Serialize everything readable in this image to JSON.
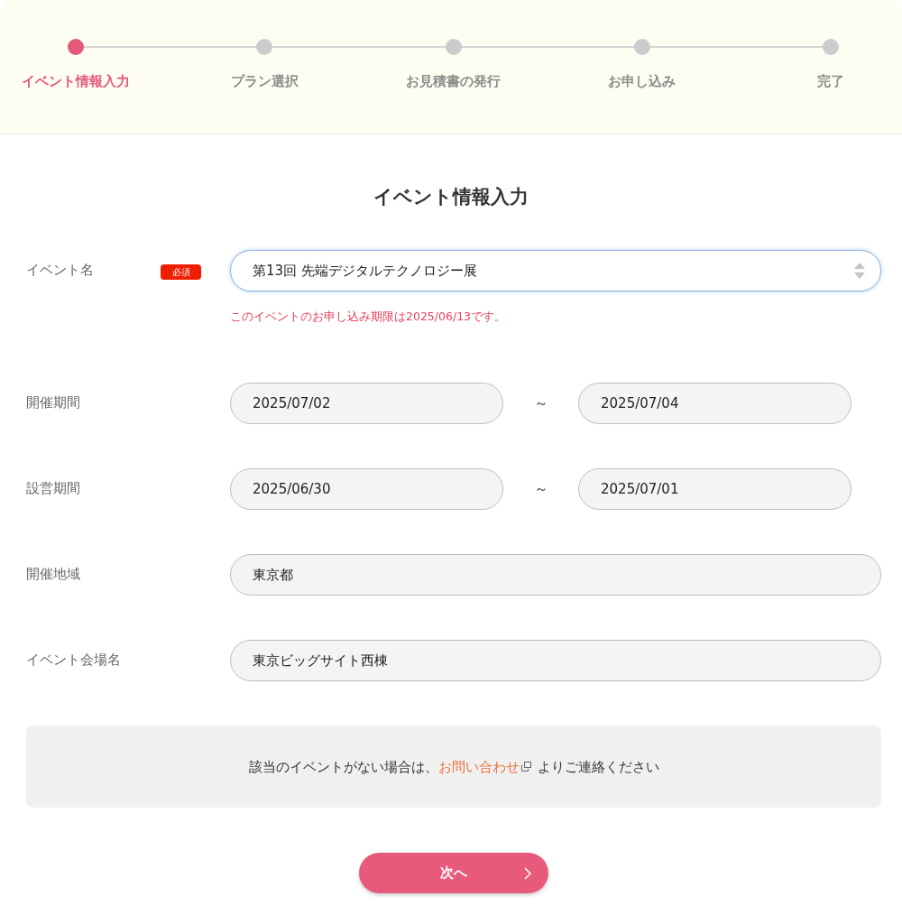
{
  "steps": [
    {
      "label": "イベント情報入力",
      "selected": true
    },
    {
      "label": "プラン選択",
      "selected": false
    },
    {
      "label": "お見積書の発行",
      "selected": false
    },
    {
      "label": "お申し込み",
      "selected": false
    },
    {
      "label": "完了",
      "selected": false
    }
  ],
  "title": "イベント情報入力",
  "fields": [
    {
      "kind": "select",
      "label": "イベント名",
      "badge": "必須",
      "value": "第13回 先端デジタルテクノロジー展",
      "focused": true,
      "note": "このイベントのお申し込み期限は2025/06/13です。"
    },
    {
      "kind": "range",
      "label": "開催期間",
      "from": "2025/07/02",
      "separator": "～",
      "to": "2025/07/04",
      "focused": false
    },
    {
      "kind": "range",
      "label": "設営期間",
      "from": "2025/06/30",
      "separator": "～",
      "to": "2025/07/01",
      "focused": false
    },
    {
      "kind": "text",
      "label": "開催地域",
      "value": "東京都",
      "focused": false
    },
    {
      "kind": "text",
      "label": "イベント会場名",
      "value": "東京ビッグサイト西棟",
      "focused": false
    }
  ],
  "notice": {
    "text_before": "該当のイベントがない場合は、",
    "link": "お問い合わせ",
    "text_after": "よりご連絡ください"
  },
  "next_button": {
    "label": "次へ"
  }
}
